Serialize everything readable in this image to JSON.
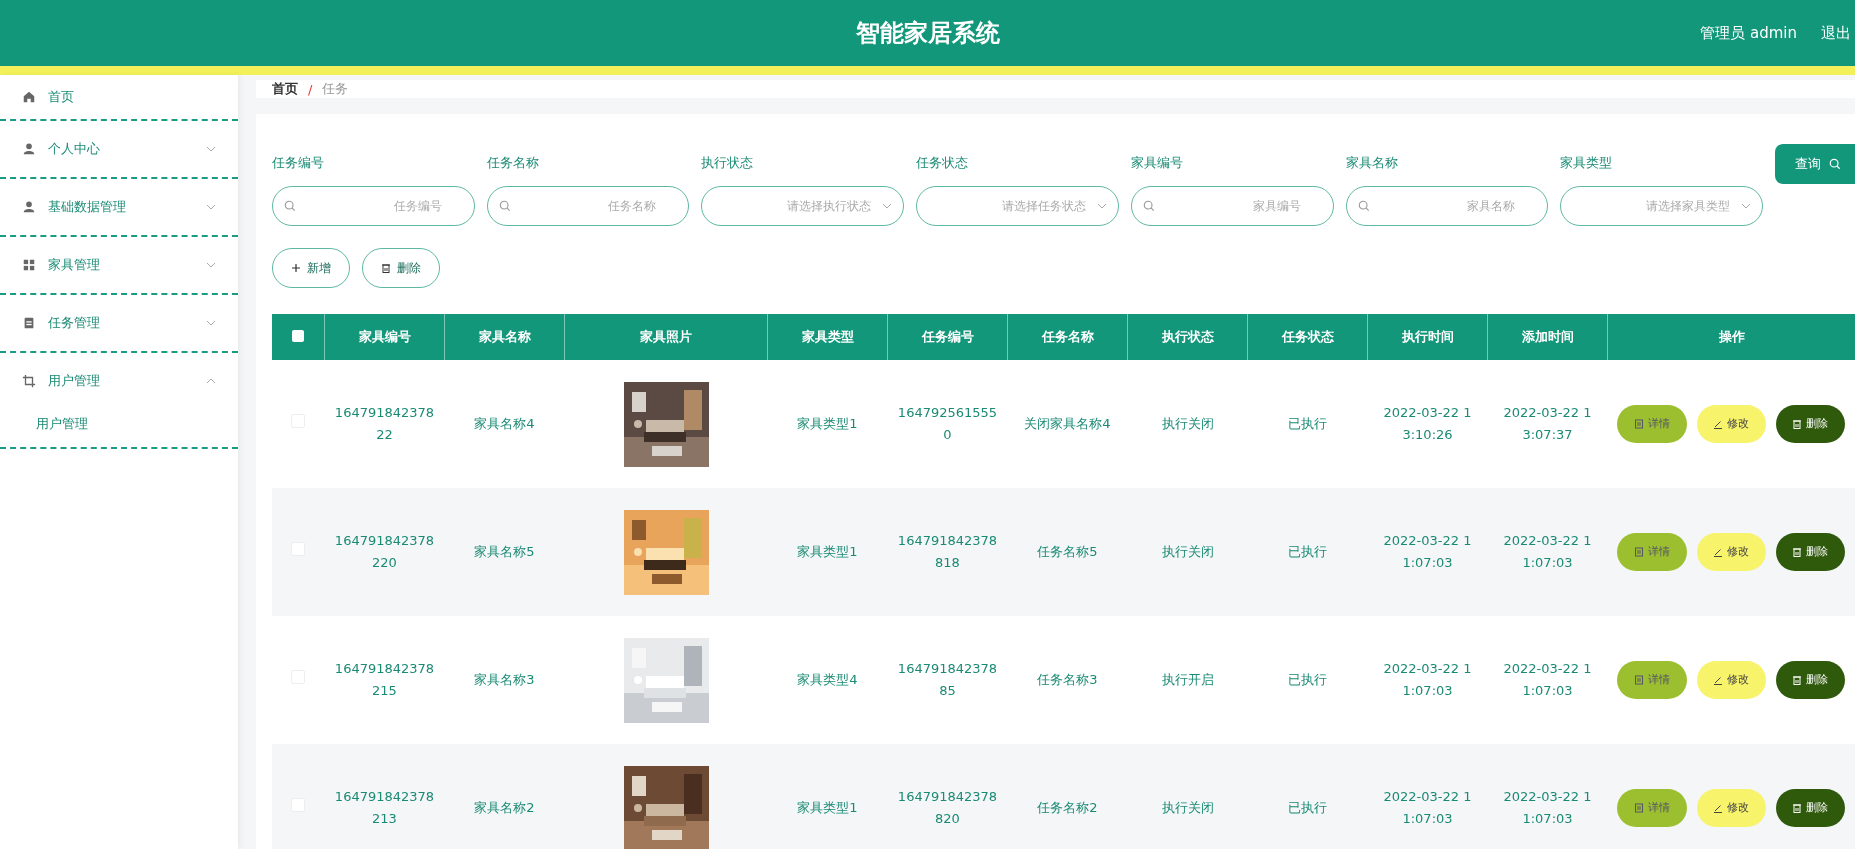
{
  "header": {
    "title": "智能家居系统",
    "user": "管理员 admin",
    "logout": "退出"
  },
  "sidebar": {
    "items": [
      {
        "label": "首页"
      },
      {
        "label": "个人中心",
        "expanded": false
      },
      {
        "label": "基础数据管理",
        "expanded": false
      },
      {
        "label": "家具管理",
        "expanded": false
      },
      {
        "label": "任务管理",
        "expanded": false
      },
      {
        "label": "用户管理",
        "expanded": true,
        "children": [
          {
            "label": "用户管理"
          }
        ]
      }
    ]
  },
  "breadcrumb": [
    "首页",
    "任务"
  ],
  "breadcrumb_separator": "/",
  "filters": [
    {
      "kind": "search",
      "label": "任务编号",
      "placeholder": "任务编号"
    },
    {
      "kind": "search",
      "label": "任务名称",
      "placeholder": "任务名称"
    },
    {
      "kind": "select",
      "label": "执行状态",
      "placeholder": "请选择执行状态"
    },
    {
      "kind": "select",
      "label": "任务状态",
      "placeholder": "请选择任务状态"
    },
    {
      "kind": "search",
      "label": "家具编号",
      "placeholder": "家具编号"
    },
    {
      "kind": "search",
      "label": "家具名称",
      "placeholder": "家具名称"
    },
    {
      "kind": "select",
      "label": "家具类型",
      "placeholder": "请选择家具类型"
    }
  ],
  "query_button": "查询",
  "actions": [
    {
      "kind": "add",
      "label": "新增"
    },
    {
      "kind": "delete",
      "label": "删除"
    }
  ],
  "table": {
    "select_all_checked": false,
    "columns": [
      "家具编号",
      "家具名称",
      "家具照片",
      "家具类型",
      "任务编号",
      "任务名称",
      "执行状态",
      "任务状态",
      "执行时间",
      "添加时间",
      "操作"
    ],
    "rows": [
      {
        "checked": false,
        "cells": [
          "16479184237822",
          "家具名称4",
          null,
          "家具类型1",
          "1647925615550",
          "关闭家具名称4",
          "执行关闭",
          "已执行",
          "2022-03-22 13:10:26",
          "2022-03-22 13:07:37"
        ],
        "photo": {
          "kind": "picture"
        },
        "buttons": [
          {
            "kind": "detail",
            "label": "详情"
          },
          {
            "kind": "edit",
            "label": "修改"
          },
          {
            "kind": "delete",
            "label": "删除"
          }
        ]
      },
      {
        "checked": false,
        "cells": [
          "164791842378220",
          "家具名称5",
          null,
          "家具类型1",
          "164791842378818",
          "任务名称5",
          "执行关闭",
          "已执行",
          "2022-03-22 11:07:03",
          "2022-03-22 11:07:03"
        ],
        "photo": {
          "kind": "picture"
        },
        "buttons": [
          {
            "kind": "detail",
            "label": "详情"
          },
          {
            "kind": "edit",
            "label": "修改"
          },
          {
            "kind": "delete",
            "label": "删除"
          }
        ]
      },
      {
        "checked": false,
        "cells": [
          "164791842378215",
          "家具名称3",
          null,
          "家具类型4",
          "16479184237885",
          "任务名称3",
          "执行开启",
          "已执行",
          "2022-03-22 11:07:03",
          "2022-03-22 11:07:03"
        ],
        "photo": {
          "kind": "picture"
        },
        "buttons": [
          {
            "kind": "detail",
            "label": "详情"
          },
          {
            "kind": "edit",
            "label": "修改"
          },
          {
            "kind": "delete",
            "label": "删除"
          }
        ]
      },
      {
        "checked": false,
        "cells": [
          "164791842378213",
          "家具名称2",
          null,
          "家具类型1",
          "164791842378820",
          "任务名称2",
          "执行关闭",
          "已执行",
          "2022-03-22 11:07:03",
          "2022-03-22 11:07:03"
        ],
        "photo": {
          "kind": "picture"
        },
        "buttons": [
          {
            "kind": "detail",
            "label": "详情"
          },
          {
            "kind": "edit",
            "label": "修改"
          },
          {
            "kind": "delete",
            "label": "删除"
          }
        ]
      }
    ]
  }
}
